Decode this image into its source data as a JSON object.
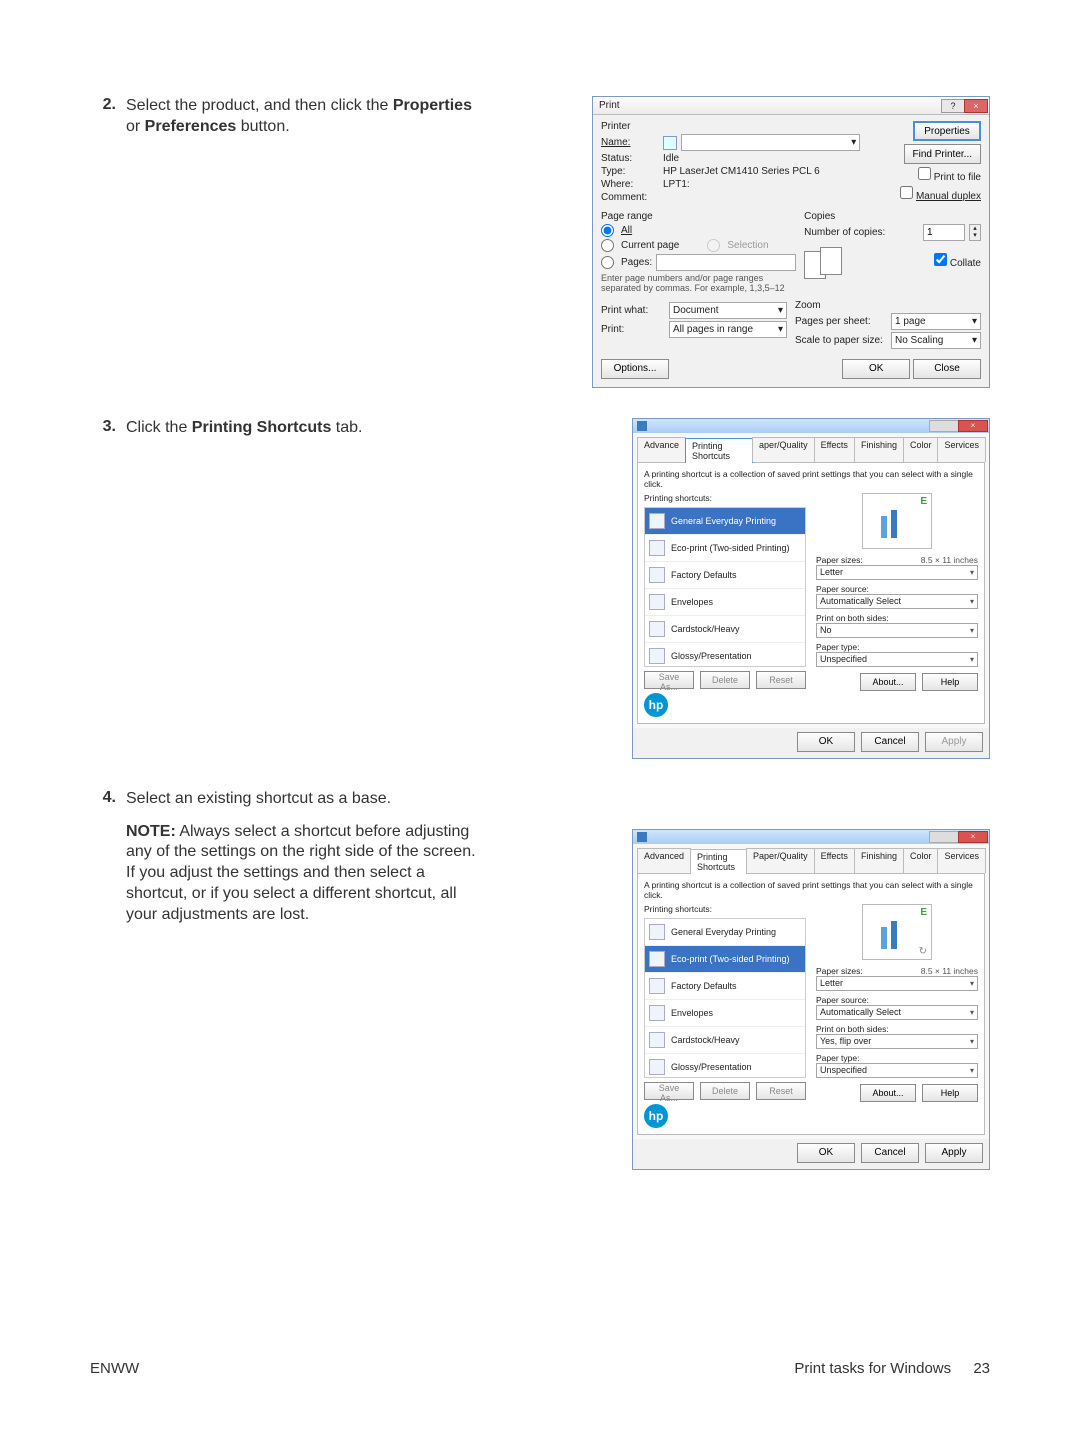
{
  "steps": {
    "s2": {
      "num": "2.",
      "text_a": "Select the product, and then click the ",
      "text_b": " or ",
      "text_c": " button.",
      "bold1": "Properties",
      "bold2": "Preferences"
    },
    "s3": {
      "num": "3.",
      "text_a": "Click the ",
      "bold1": "Printing Shortcuts",
      "text_b": " tab."
    },
    "s4": {
      "num": "4.",
      "text_a": "Select an existing shortcut as a base.",
      "note_label": "NOTE:",
      "note_text": "Always select a shortcut before adjusting any of the settings on the right side of the screen. If you adjust the settings and then select a shortcut, or if you select a different shortcut, all your adjustments are lost."
    }
  },
  "print_dialog": {
    "title": "Print",
    "printer_section": "Printer",
    "name_lbl": "Name:",
    "status_lbl": "Status:",
    "status_val": "Idle",
    "type_lbl": "Type:",
    "type_val": "HP LaserJet CM1410 Series PCL 6",
    "where_lbl": "Where:",
    "where_val": "LPT1:",
    "comment_lbl": "Comment:",
    "btn_properties": "Properties",
    "btn_find": "Find Printer...",
    "chk_printfile": "Print to file",
    "chk_duplex": "Manual duplex",
    "page_range": "Page range",
    "r_all": "All",
    "r_current": "Current page",
    "r_selection": "Selection",
    "r_pages": "Pages:",
    "pages_hint": "Enter page numbers and/or page ranges separated by commas. For example, 1,3,5–12",
    "copies_lbl": "Copies",
    "num_copies_lbl": "Number of copies:",
    "num_copies_val": "1",
    "collate": "Collate",
    "print_what_lbl": "Print what:",
    "print_what_val": "Document",
    "print_lbl": "Print:",
    "print_val": "All pages in range",
    "zoom_lbl": "Zoom",
    "pps_lbl": "Pages per sheet:",
    "pps_val": "1 page",
    "scale_lbl": "Scale to paper size:",
    "scale_val": "No Scaling",
    "btn_options": "Options...",
    "btn_ok": "OK",
    "btn_close": "Close"
  },
  "props_common": {
    "tabs": [
      "Advanced",
      "Printing Shortcuts",
      "Paper/Quality",
      "Effects",
      "Finishing",
      "Color",
      "Services"
    ],
    "desc": "A printing shortcut is a collection of saved print settings that you can select with a single click.",
    "list_label": "Printing shortcuts:",
    "items": [
      "General Everyday Printing",
      "Eco-print (Two-sided Printing)",
      "Factory Defaults",
      "Envelopes",
      "Cardstock/Heavy",
      "Glossy/Presentation"
    ],
    "btn_saveas": "Save As...",
    "btn_delete": "Delete",
    "btn_reset": "Reset",
    "papersizes_lbl": "Paper sizes:",
    "papersizes_dim": "8.5 × 11 inches",
    "papersizes_val": "Letter",
    "papersource_lbl": "Paper source:",
    "papersource_val": "Automatically Select",
    "printboth_lbl": "Print on both sides:",
    "papertype_lbl": "Paper type:",
    "papertype_val": "Unspecified",
    "btn_about": "About...",
    "btn_help": "Help",
    "btn_ok": "OK",
    "btn_cancel": "Cancel",
    "btn_apply": "Apply"
  },
  "props3": {
    "selected_index": 0,
    "printboth_val": "No",
    "active_tab_trim": "Advance",
    "tab1_trim": "aper/Quality"
  },
  "props4": {
    "selected_index": 1,
    "printboth_val": "Yes, flip over"
  },
  "footer": {
    "left": "ENWW",
    "right": "Print tasks for Windows",
    "page": "23"
  }
}
